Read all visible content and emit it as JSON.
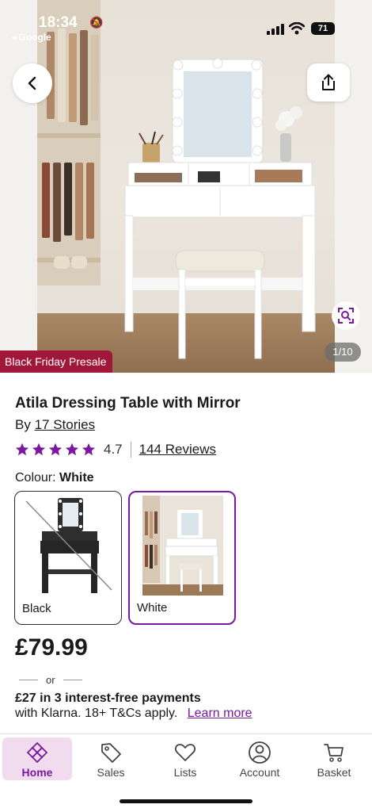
{
  "status_bar": {
    "time": "18:34",
    "back_app": "◂ Google",
    "battery": "71"
  },
  "hero": {
    "image_counter": "1/10",
    "promo_badge": "Black Friday Presale"
  },
  "product": {
    "title": "Atila Dressing Table with Mirror",
    "brand_prefix": "By",
    "brand": "17 Stories",
    "rating": "4.7",
    "stars_filled": 5,
    "reviews_link": "144 Reviews",
    "colour_label": "Colour:",
    "colour_selected": "White",
    "swatches": [
      {
        "label": "Black",
        "available": false
      },
      {
        "label": "White",
        "available": true
      }
    ],
    "price": "£79.99",
    "or_text": "or",
    "klarna_line1": "£27 in 3 interest-free payments",
    "klarna_line2": "with Klarna. 18+ T&Cs apply.",
    "klarna_learn": "Learn more"
  },
  "tabs": [
    {
      "label": "Home",
      "icon": "home-icon",
      "active": true
    },
    {
      "label": "Sales",
      "icon": "tag-icon",
      "active": false
    },
    {
      "label": "Lists",
      "icon": "heart-icon",
      "active": false
    },
    {
      "label": "Account",
      "icon": "account-icon",
      "active": false
    },
    {
      "label": "Basket",
      "icon": "basket-icon",
      "active": false
    }
  ],
  "colors": {
    "accent": "#7b189f",
    "promo": "#a0173a",
    "star": "#7b189f"
  }
}
